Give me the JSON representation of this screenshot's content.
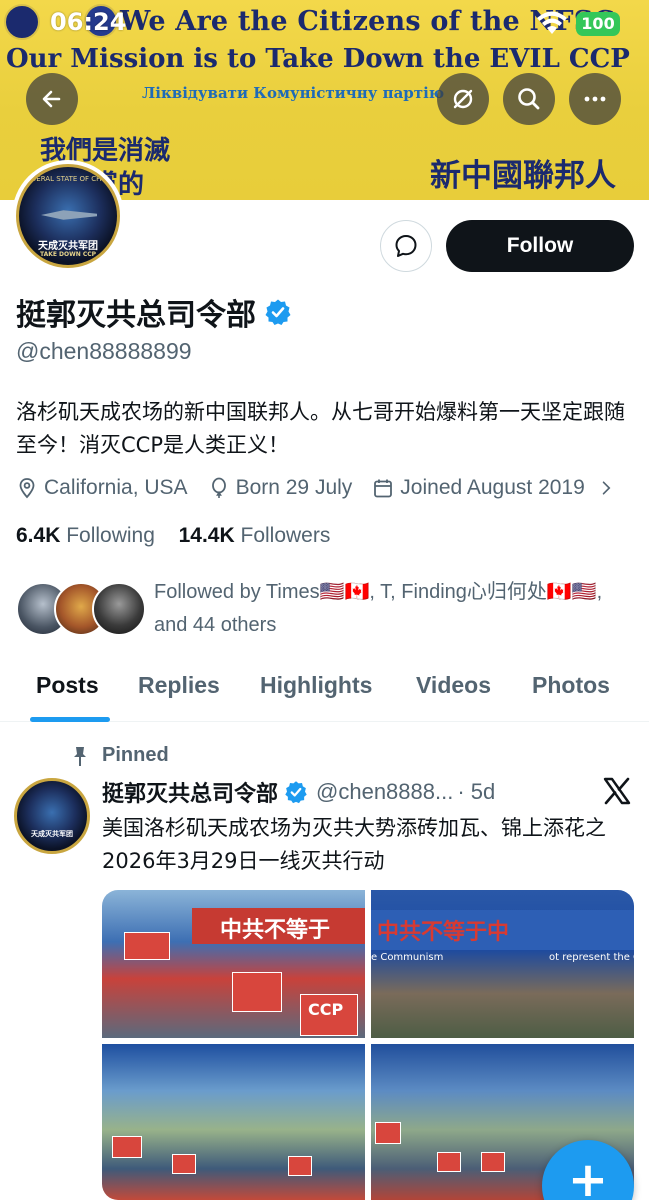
{
  "status_bar": {
    "time": "06:24",
    "battery": "100"
  },
  "banner": {
    "line1": "We Are the Citizens of the NFSC",
    "line2": "Our Mission is to Take Down the EVIL CCP",
    "line3": "Ліквідувати Комуністичну партію",
    "cn_left_1": "我們是消滅",
    "cn_left_2": "共產黨的",
    "cn_right": "新中國聯邦人"
  },
  "nav": {
    "back_icon": "arrow-left-icon",
    "translate_icon": "no-translate-icon",
    "search_icon": "search-icon",
    "more_icon": "more-icon"
  },
  "avatar": {
    "text_top": "FEDERAL STATE OF CHINA",
    "text_main": "天成灭共军团",
    "text_sub": "TAKE DOWN CCP"
  },
  "actions": {
    "message_icon": "message-icon",
    "follow_label": "Follow"
  },
  "profile": {
    "display_name": "挺郭灭共总司令部",
    "handle": "@chen88888899",
    "bio": "洛杉矶天成农场的新中国联邦人。从七哥开始爆料第一天坚定跟随至今！消灭CCP是人类正义！",
    "location": "California, USA",
    "birthday": "Born 29 July",
    "joined": "Joined August 2019"
  },
  "stats": {
    "following_count": "6.4K",
    "following_label": "Following",
    "followers_count": "14.4K",
    "followers_label": "Followers"
  },
  "followed_by": {
    "text": "Followed by Times🇺🇸🇨🇦, T, Finding心归何处🇨🇦🇺🇸, and 44 others"
  },
  "tabs": [
    "Posts",
    "Replies",
    "Highlights",
    "Videos",
    "Photos"
  ],
  "post": {
    "pinned_label": "Pinned",
    "author": "挺郭灭共总司令部",
    "handle": "@chen8888...",
    "time": "· 5d",
    "text": "美国洛杉矶天成农场为灭共大势添砖加瓦、锦上添花之2026年3月29日一线灭共行动",
    "photo_text_1": "中共不等于",
    "photo_text_2": "中共不等于中",
    "photo_text_3": "e Communism",
    "photo_text_4": "ot represent the C",
    "sign_ccp": "CCP"
  },
  "fab": {
    "label": "+"
  },
  "colors": {
    "accent": "#1d9bf0",
    "banner": "#f0d447",
    "text": "#0f1419",
    "muted": "#536471"
  }
}
